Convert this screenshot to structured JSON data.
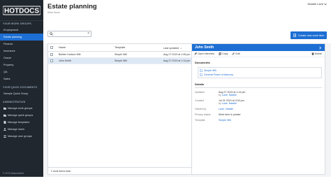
{
  "brand": {
    "logo_text": "HOTDOCS"
  },
  "sidebar": {
    "work_groups_heading": "YOUR WORK GROUPS",
    "items": [
      {
        "label": "Employment"
      },
      {
        "label": "Estate planning"
      },
      {
        "label": "Finance"
      },
      {
        "label": "Insurance"
      },
      {
        "label": "Oracle"
      },
      {
        "label": "Property"
      },
      {
        "label": "QA"
      },
      {
        "label": "Sales"
      }
    ],
    "quick_docs_heading": "YOUR QUICK DOCUMENTS",
    "quick_items": [
      {
        "label": "Sample Quick Group"
      }
    ],
    "admin_heading": "ADMINISTRATION",
    "admin_items": [
      {
        "label": "Manage work groups",
        "icon": "folder-icon"
      },
      {
        "label": "Manage quick groups",
        "icon": "folder-icon"
      },
      {
        "label": "Manage templates",
        "icon": "file-icon"
      },
      {
        "label": "Manage users",
        "icon": "user-icon"
      },
      {
        "label": "Manage user groups",
        "icon": "users-icon"
      }
    ],
    "copyright": "© 2019 AbacusNext"
  },
  "header": {
    "title": "Estate planning",
    "subtitle": "Work items",
    "user_name": "Natalie Lane",
    "create_label": "Create new work item"
  },
  "search": {
    "value": "",
    "placeholder": ""
  },
  "table": {
    "columns": [
      "Name",
      "Template",
      "Last updated"
    ],
    "rows": [
      {
        "name": "Builder Hudson Will",
        "template": "Simple Will",
        "updated": "Aug 27 2019 at 1:06 pm"
      },
      {
        "name": "John Smith",
        "template": "Simple Will",
        "updated": "Aug 27 2019 at 1:14 pm"
      }
    ],
    "footer": "2 work items total"
  },
  "detail": {
    "title": "John Smith",
    "tools": {
      "open": "Open interview",
      "copy": "Copy",
      "edit": "Edit",
      "delete": "Delete"
    },
    "documents_heading": "Documents",
    "documents": [
      {
        "label": "Simple Will"
      },
      {
        "label": "General Power of Attorney"
      }
    ],
    "details_heading": "Details",
    "fields": {
      "updated_label": "Updated",
      "updated_value": "Aug 27 2019 at 1:14 pm",
      "updated_by_prefix": "by",
      "updated_by": "Lane, Natalie",
      "created_label": "Created",
      "created_value": "Jul 31 2019 at 3:04 pm",
      "created_by_prefix": "by",
      "created_by": "Lane, Natalie",
      "owned_label": "Owned by",
      "owned_value": "Lane, Natalie",
      "privacy_label": "Privacy status",
      "privacy_value": "Work item is private",
      "template_label": "Template",
      "template_value": "Simple Will"
    }
  },
  "colors": {
    "accent": "#1d6fd3",
    "sidebar_bg": "#21272e",
    "selected_row": "#dde8f5"
  }
}
